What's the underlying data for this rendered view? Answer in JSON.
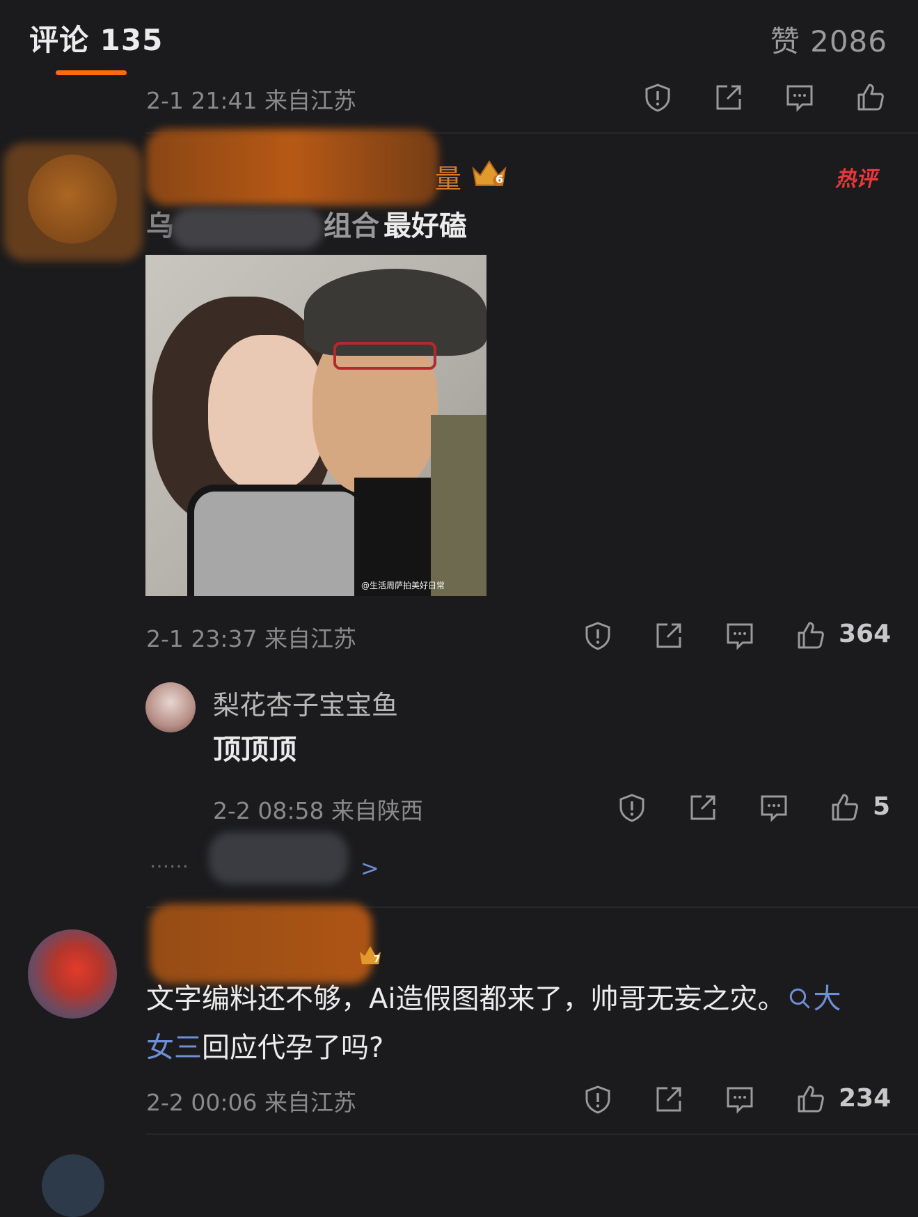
{
  "header": {
    "comments_label": "评论 135",
    "likes_label": "赞 2086"
  },
  "prev_comment": {
    "meta": "2-1 21:41  来自江苏"
  },
  "hot_comment": {
    "username_visible_char": "量",
    "level": "6",
    "hot_badge": "热评",
    "text_visible_part": "最好磕",
    "text_prefix_visible": "乌",
    "text_mid_visible": "组合",
    "photo_watermark": "@生活周萨拍美好日常",
    "meta": "2-1 23:37  来自江苏",
    "like_count": "364"
  },
  "reply": {
    "username": "梨花杏子宝宝鱼",
    "text": "顶顶顶",
    "meta": "2-2 08:58  来自陕西",
    "like_count": "5",
    "more_dots": "……",
    "more_arrow": ">"
  },
  "second_comment": {
    "level": "7",
    "text_before_topic": "文字编料还不够，Ai造假图都来了，帅哥无妄之灾。",
    "topic": "大女三",
    "text_after_topic": "回应代孕了吗?",
    "meta": "2-2 00:06  来自江苏",
    "like_count": "234"
  },
  "icons": [
    "report-icon",
    "share-icon",
    "reply-icon",
    "like-icon",
    "search-icon"
  ],
  "colors": {
    "background": "#1b1b1d",
    "accent": "#ff6a0e",
    "topic": "#6f8ed6",
    "hot": "#e8383a"
  }
}
